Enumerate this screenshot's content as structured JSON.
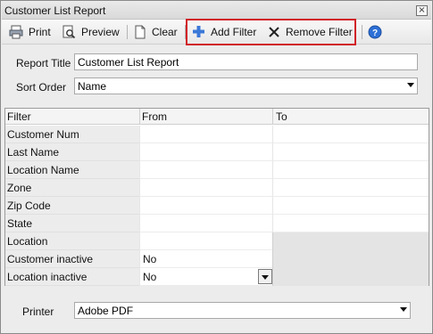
{
  "window": {
    "title": "Customer List Report",
    "close_glyph": "×"
  },
  "toolbar": {
    "print_label": "Print",
    "preview_label": "Preview",
    "clear_label": "Clear",
    "add_filter_label": "Add Filter",
    "remove_filter_label": "Remove Filter",
    "icons": [
      "printer-icon",
      "preview-icon",
      "clear-icon",
      "add-filter-icon",
      "remove-filter-icon",
      "help-icon"
    ]
  },
  "form": {
    "report_title_label": "Report Title",
    "report_title_value": "Customer List Report",
    "sort_order_label": "Sort Order",
    "sort_order_value": "Name"
  },
  "grid": {
    "columns": [
      "Filter",
      "From",
      "To"
    ],
    "rows": [
      {
        "filter": "Customer Num",
        "from": "",
        "to_enabled": true
      },
      {
        "filter": "Last Name",
        "from": "",
        "to_enabled": true
      },
      {
        "filter": "Location Name",
        "from": "",
        "to_enabled": true
      },
      {
        "filter": "Zone",
        "from": "",
        "to_enabled": true
      },
      {
        "filter": "Zip Code",
        "from": "",
        "to_enabled": true
      },
      {
        "filter": "State",
        "from": "",
        "to_enabled": true
      },
      {
        "filter": "Location",
        "from": "",
        "to_enabled": false
      },
      {
        "filter": "Customer inactive",
        "from": "No",
        "to_enabled": false
      },
      {
        "filter": "Location inactive",
        "from": "No",
        "to_enabled": false
      }
    ]
  },
  "printer": {
    "label": "Printer",
    "value": "Adobe PDF"
  },
  "colors": {
    "highlight": "#d12127",
    "accent_blue": "#2c6fd6"
  }
}
